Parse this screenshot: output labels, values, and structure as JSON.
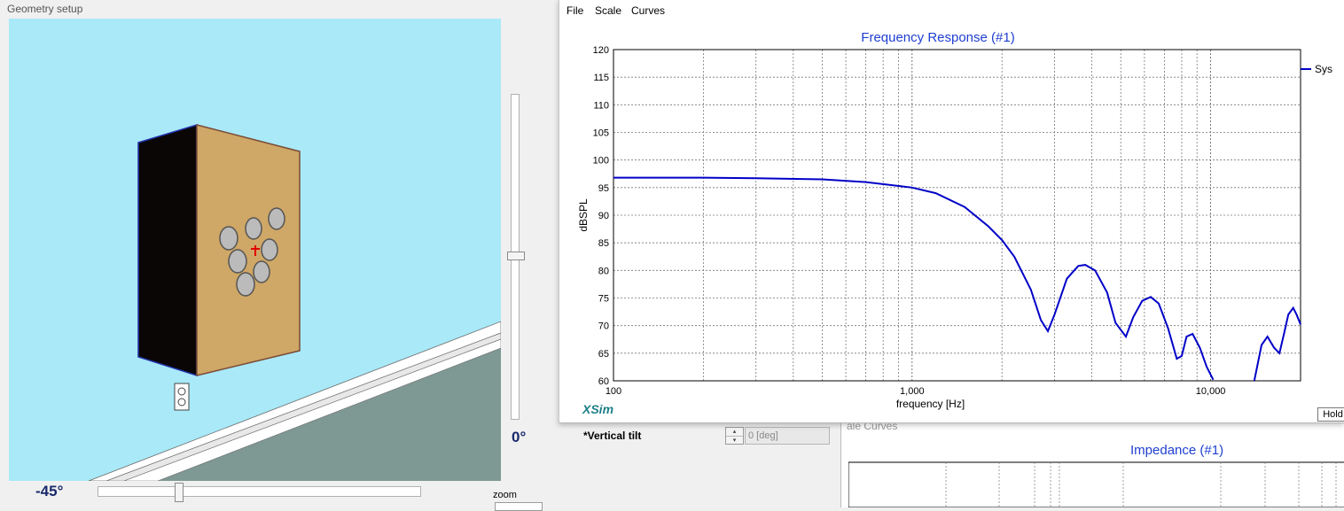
{
  "geometry": {
    "title": "Geometry setup",
    "vertical_angle": "0°",
    "horizontal_angle": "-45°",
    "zoom_label": "zoom",
    "colors": {
      "wall": "#a9e9f8",
      "floor": "#7e9894",
      "baffle": "#cfa766",
      "side": "#0a0606",
      "driver": "#bbbbbb"
    }
  },
  "freq_window": {
    "menu": [
      "File",
      "Scale",
      "Curves"
    ],
    "brand": "XSim",
    "hold_label": "Hold"
  },
  "chart_data": {
    "type": "line",
    "title": "Frequency Response (#1)",
    "xlabel": "frequency [Hz]",
    "ylabel": "dBSPL",
    "xscale": "log",
    "xlim": [
      100,
      20000
    ],
    "ylim": [
      60,
      120
    ],
    "yticks": [
      60,
      65,
      70,
      75,
      80,
      85,
      90,
      95,
      100,
      105,
      110,
      115,
      120
    ],
    "xtick_labels": [
      {
        "value": 100,
        "label": "100"
      },
      {
        "value": 1000,
        "label": "1,000"
      },
      {
        "value": 10000,
        "label": "10,000"
      }
    ],
    "grid": true,
    "legend": "right",
    "series": [
      {
        "name": "Sys",
        "color": "#0000c8",
        "x": [
          100,
          200,
          300,
          500,
          700,
          1000,
          1200,
          1500,
          1800,
          2000,
          2200,
          2500,
          2700,
          2850,
          3000,
          3300,
          3600,
          3800,
          4100,
          4500,
          4800,
          5200,
          5500,
          5900,
          6300,
          6700,
          7200,
          7700,
          8000,
          8300,
          8700,
          9200,
          9700,
          10200
        ],
        "y": [
          96.8,
          96.8,
          96.7,
          96.5,
          96.0,
          95.0,
          94.0,
          91.5,
          88.0,
          85.5,
          82.5,
          76.5,
          71.0,
          69.0,
          72.0,
          78.5,
          80.8,
          81.0,
          80.0,
          76.0,
          70.5,
          68.0,
          71.5,
          74.5,
          75.2,
          74.0,
          69.5,
          64.0,
          64.5,
          68.0,
          68.5,
          66.0,
          62.5,
          60.2
        ]
      },
      {
        "name": "",
        "color": "#0000c8",
        "x": [
          14000,
          14800,
          15500,
          16300,
          17000,
          17600,
          18200,
          18900,
          19400,
          20000
        ],
        "y": [
          60.0,
          66.5,
          68.0,
          66.0,
          65.0,
          68.5,
          72.0,
          73.2,
          72.0,
          70.2
        ]
      }
    ]
  },
  "tilt": {
    "label": "*Vertical tilt",
    "value": "0 [deg]",
    "up": "▴",
    "down": "▾"
  },
  "impedance": {
    "menu_partial": "ale   Curves",
    "title": "Impedance (#1)"
  }
}
